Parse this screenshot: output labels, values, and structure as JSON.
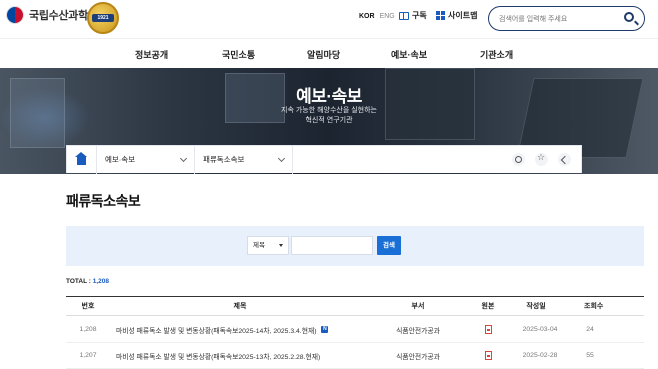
{
  "header": {
    "org_name": "국립수산과학원",
    "badge_text": "1921",
    "lang_kor": "KOR",
    "lang_eng": "ENG",
    "subscribe_label": "구독",
    "sitemap_label": "사이트맵",
    "search_placeholder": "검색어를 입력해 주세요"
  },
  "gnb": [
    "정보공개",
    "국민소통",
    "알림마당",
    "예보·속보",
    "기관소개"
  ],
  "banner": {
    "title": "예보·속보",
    "subtitle_1": "지속 가능한 해양수산을 실현하는",
    "subtitle_2": "혁신적 연구기관"
  },
  "breadcrumb": {
    "level1": "예보·속보",
    "level2": "패류독소속보"
  },
  "page_title": "패류독소속보",
  "search_form": {
    "select_value": "제목",
    "button_label": "검색"
  },
  "total": {
    "label": "TOTAL : ",
    "count": "1,208"
  },
  "table": {
    "headers": {
      "no": "번호",
      "title": "제목",
      "dept": "부서",
      "orig": "원본",
      "date": "작성일",
      "views": "조회수"
    },
    "rows": [
      {
        "no": "1,208",
        "title": "마비성 패류독소 발생 및 변동상황(패독속보2025-14차, 2025.3.4.현재)",
        "new": "N",
        "dept": "식품안전가공과",
        "date": "2025-03-04",
        "views": "24"
      },
      {
        "no": "1,207",
        "title": "마비성 패류독소 발생 및 변동상황(패독속보2025-13차, 2025.2.28.현재)",
        "dept": "식품안전가공과",
        "date": "2025-02-28",
        "views": "55"
      }
    ]
  },
  "colors": {
    "primary": "#1a5bbf",
    "search_bg": "#e8f1fb",
    "button": "#1a6fd6"
  }
}
